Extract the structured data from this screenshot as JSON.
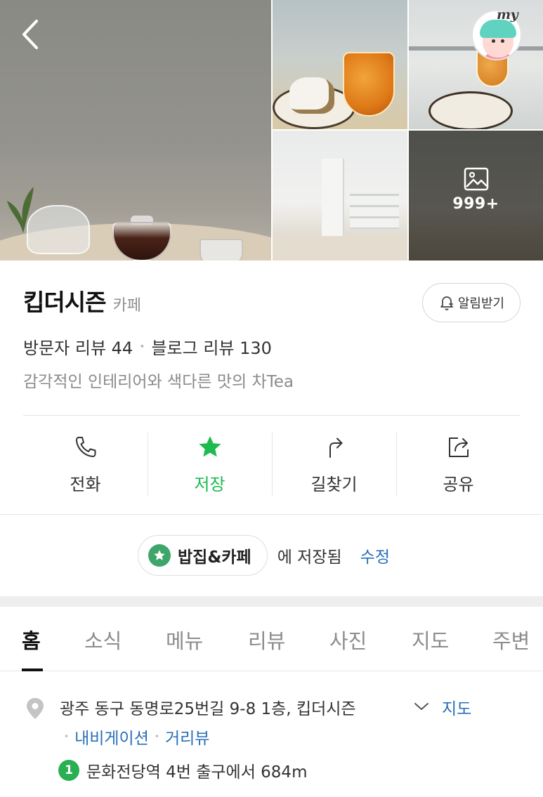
{
  "photos": {
    "more_count": "999+",
    "my_label": "my"
  },
  "place": {
    "name": "킵더시즌",
    "category": "카페",
    "alarm_label": "알림받기",
    "visitor_reviews": "방문자 리뷰 44",
    "blog_reviews": "블로그 리뷰 130",
    "description": "감각적인 인테리어와 색다른 맛의 차Tea"
  },
  "actions": [
    {
      "label": "전화",
      "icon": "phone-icon"
    },
    {
      "label": "저장",
      "icon": "star-icon",
      "color": "#1dbb4e"
    },
    {
      "label": "길찾기",
      "icon": "directions-icon"
    },
    {
      "label": "공유",
      "icon": "share-icon"
    }
  ],
  "saved": {
    "folder": "밥집&카페",
    "suffix": "에 저장됨",
    "edit": "수정",
    "folder_color": "#3ea66a"
  },
  "tabs": [
    {
      "label": "홈",
      "active": true
    },
    {
      "label": "소식"
    },
    {
      "label": "메뉴"
    },
    {
      "label": "리뷰"
    },
    {
      "label": "사진"
    },
    {
      "label": "지도"
    },
    {
      "label": "주변"
    }
  ],
  "address": {
    "text": "광주 동구 동명로25번길 9-8 1층, 킵더시즌",
    "map_link": "지도",
    "navigation": "내비게이션",
    "street_view": "거리뷰",
    "metro_line": "1",
    "metro_text": "문화전당역 4번 출구에서 684m",
    "metro_color": "#2ab052"
  },
  "colors": {
    "accent_green": "#1dbb4e",
    "link_blue": "#2a6fb9"
  }
}
